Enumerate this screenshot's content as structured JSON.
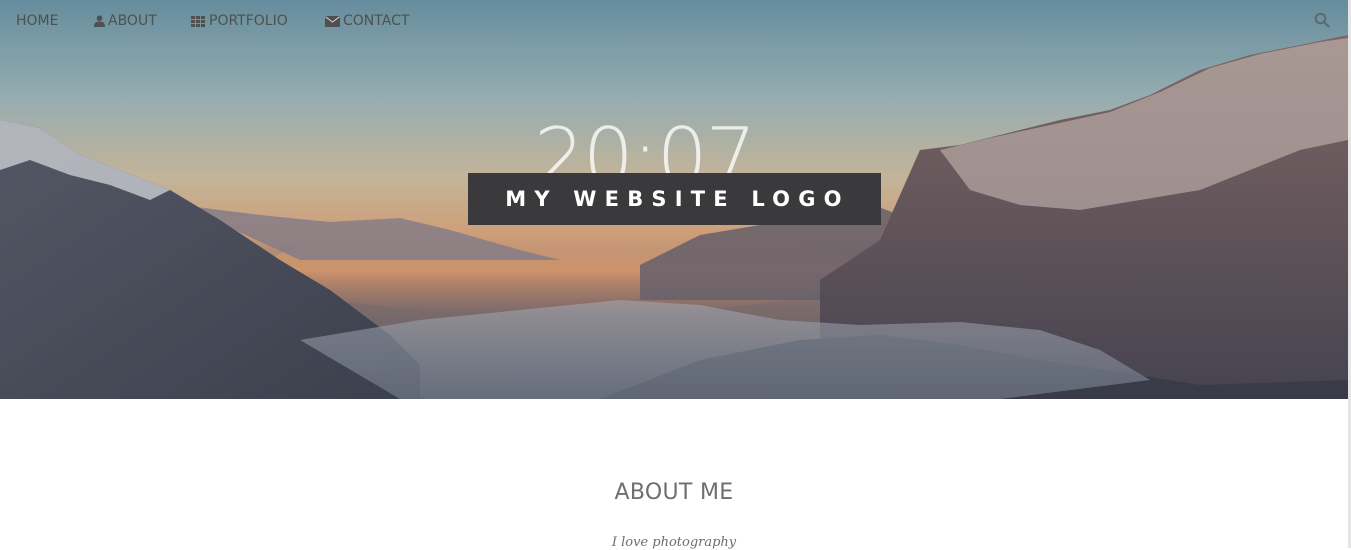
{
  "nav": {
    "home": "HOME",
    "about": "ABOUT",
    "portfolio": "PORTFOLIO",
    "contact": "CONTACT",
    "icons": {
      "about": "user-icon",
      "portfolio": "grid-icon",
      "contact": "envelope-icon",
      "search": "search-icon"
    }
  },
  "hero": {
    "clock": "20:07",
    "logo": "MY WEBSITE LOGO"
  },
  "about": {
    "title": "ABOUT ME",
    "subtitle": "I love photography"
  },
  "colors": {
    "nav_text": "#505050",
    "logo_bg": "#3a3a3c",
    "heading": "#6e6e6e"
  }
}
